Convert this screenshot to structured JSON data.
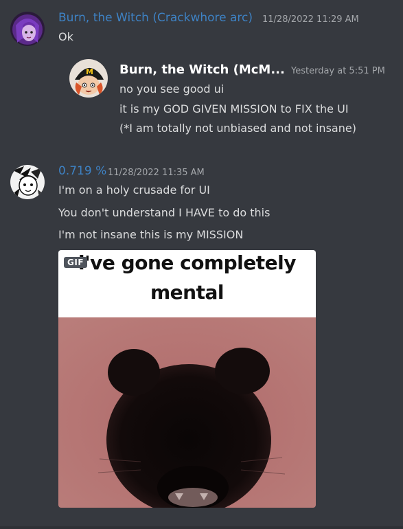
{
  "messages": [
    {
      "author": "Burn, the Witch (Crackwhore arc)",
      "author_color": "#3e82c4",
      "timestamp": "11/28/2022 11:29 AM",
      "lines": [
        "Ok"
      ],
      "avatar_icon": "purple-haired-character-avatar"
    },
    {
      "author": "Burn, the Witch (McM...",
      "author_color": "#ffffff",
      "timestamp": "Yesterday at 5:51 PM",
      "lines": [
        "no you see good ui",
        "it is my GOD GIVEN MISSION to FIX the UI",
        "(*I am totally not unbiased and not insane)"
      ],
      "avatar_icon": "mcdonalds-cap-character-avatar"
    },
    {
      "author": "0.719 %",
      "author_color": "#3e82c4",
      "timestamp": "11/28/2022 11:35 AM",
      "lines": [
        "I'm on a holy crusade for UI",
        "You don't understand I HAVE to do this",
        "I'm not insane this is my MISSION"
      ],
      "avatar_icon": "manga-character-avatar",
      "attachment": {
        "badge": "GIF",
        "caption_line1": "i've gone completely",
        "caption_line2": "mental"
      }
    }
  ]
}
